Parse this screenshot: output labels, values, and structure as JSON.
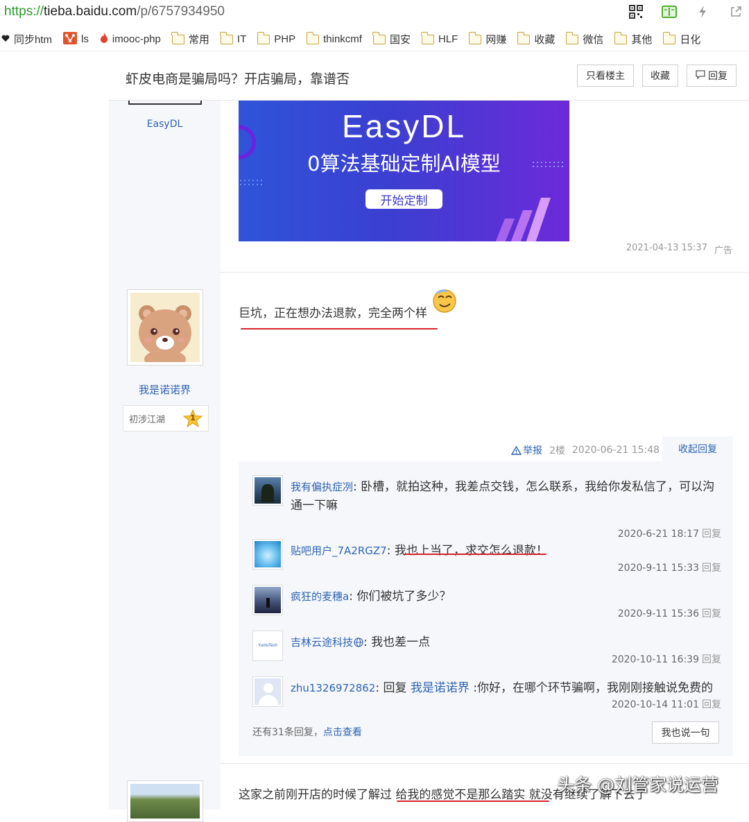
{
  "browser": {
    "url_protocol": "https://",
    "url_host": "tieba.baidu.com",
    "url_path": "/p/6757934950"
  },
  "bookmarks": [
    {
      "label": "同步htm",
      "icon": "heart-icon"
    },
    {
      "label": "ls",
      "icon": "git-icon"
    },
    {
      "label": "imooc-php",
      "icon": "flame-icon"
    },
    {
      "label": "常用",
      "icon": "folder-icon"
    },
    {
      "label": "IT",
      "icon": "folder-icon"
    },
    {
      "label": "PHP",
      "icon": "folder-icon"
    },
    {
      "label": "thinkcmf",
      "icon": "folder-icon"
    },
    {
      "label": "国安",
      "icon": "folder-icon"
    },
    {
      "label": "HLF",
      "icon": "folder-icon"
    },
    {
      "label": "网赚",
      "icon": "folder-icon"
    },
    {
      "label": "收藏",
      "icon": "folder-icon"
    },
    {
      "label": "微信",
      "icon": "folder-icon"
    },
    {
      "label": "其他",
      "icon": "folder-icon"
    },
    {
      "label": "日化",
      "icon": "folder-icon"
    }
  ],
  "thread": {
    "title": "虾皮电商是骗局吗？开店骗局，靠谱否",
    "btn_only_op": "只看楼主",
    "btn_favorite": "收藏",
    "btn_reply": "回复"
  },
  "ad": {
    "username": "EasyDL",
    "banner_title": "EasyDL",
    "banner_sub": "0算法基础定制AI模型",
    "banner_btn": "开始定制",
    "time": "2021-04-13 15:37",
    "tag": "广告"
  },
  "post2": {
    "username": "我是诺诺界",
    "level_name": "初涉江湖",
    "level_num": "1",
    "content": "巨坑，正在想办法退款，完全两个样",
    "report": "举报",
    "floor": "2楼",
    "time": "2020-06-21 15:48",
    "collapse": "收起回复",
    "replies": [
      {
        "user": "我有偏执症冽",
        "text": "卧槽，就拍这种，我差点交钱，怎么联系，我给你发私信了，可以沟通一下嘛",
        "time": "2020-6-21 18:17",
        "reply": "回复"
      },
      {
        "user": "贴吧用户_7A2RGZ7",
        "text": "我也上当了，求交怎么退款！",
        "time": "2020-9-11 15:33",
        "reply": "回复"
      },
      {
        "user": "疯狂的麦穗a",
        "text": "你们被坑了多少？",
        "time": "2020-9-11 15:36",
        "reply": "回复"
      },
      {
        "user": "吉林云途科技",
        "text": "我也差一点",
        "time": "2020-10-11 16:39",
        "reply": "回复",
        "avatar_text": "YunluTech"
      },
      {
        "user": "zhu1326972862",
        "prefix": "回复",
        "mention": "我是诺诺界",
        "text": ":你好，在哪个环节骗啊，我刚刚接触说免费的",
        "time": "2020-10-14 11:01",
        "reply": "回复"
      }
    ],
    "more_text": "还有31条回复，",
    "more_link": "点击查看",
    "say_btn": "我也说一句"
  },
  "post3": {
    "content": "这家之前刚开店的时候了解过 给我的感觉不是那么踏实 就没有继续了解下去了"
  },
  "watermark": "头条 @刘管家说运营",
  "colors": {
    "link": "#2d64b3",
    "url_green": "#2b9a2b",
    "underline_red": "#d7232b"
  }
}
